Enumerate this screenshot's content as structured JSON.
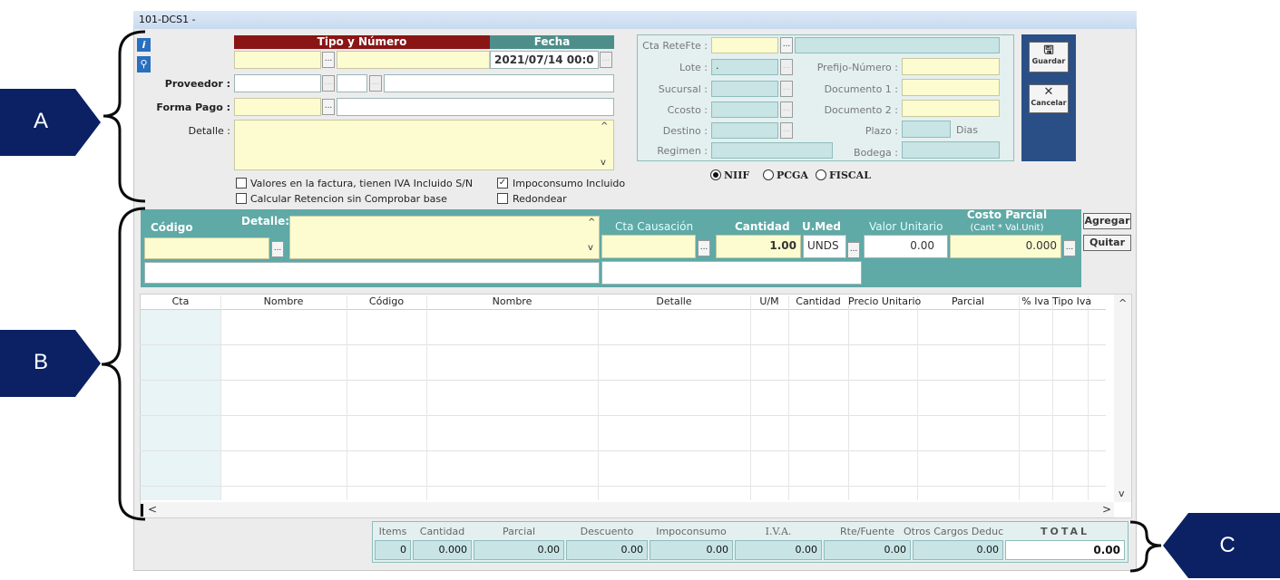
{
  "window": {
    "title": "101-DCS1 -"
  },
  "header": {
    "tipo_numero_label": "Tipo y Número",
    "fecha_label": "Fecha",
    "fecha_value": "2021/07/14 00:0",
    "proveedor_label": "Proveedor :",
    "forma_pago_label": "Forma Pago :",
    "detalle_label": "Detalle :",
    "checks": [
      {
        "label": "Valores en la factura, tienen  IVA Incluido S/N",
        "checked": false
      },
      {
        "label": "Calcular Retencion sin Comprobar base",
        "checked": false
      },
      {
        "label": "Impoconsumo Incluido",
        "checked": true
      },
      {
        "label": "Redondear",
        "checked": false
      }
    ]
  },
  "right_panel": {
    "cta_retefte": "Cta ReteFte :",
    "lote": "Lote :",
    "lote_value": ".",
    "sucursal": "Sucursal :",
    "ccosto": "Ccosto :",
    "destino": "Destino :",
    "regimen": "Regimen :",
    "prefijo": "Prefijo-Número :",
    "documento1": "Documento 1 :",
    "documento2": "Documento 2 :",
    "plazo": "Plazo :",
    "dias": "Dias",
    "bodega": "Bodega :"
  },
  "radios": [
    {
      "label": "NIIF",
      "selected": true
    },
    {
      "label": "PCGA",
      "selected": false
    },
    {
      "label": "FISCAL",
      "selected": false
    }
  ],
  "actions": {
    "guardar": "Guardar",
    "cancelar": "Cancelar",
    "agregar": "Agregar",
    "quitar": "Quitar"
  },
  "line": {
    "codigo": "Código",
    "detalle": "Detalle:",
    "cta_causacion": "Cta Causación",
    "cantidad": "Cantidad",
    "umed": "U.Med",
    "valor_unitario": "Valor Unitario",
    "costo_parcial": "Costo Parcial",
    "costo_parcial_sub": "(Cant * Val.Unit)",
    "cantidad_value": "1.00",
    "umed_value": "UNDS",
    "valor_value": "0.00",
    "costo_value": "0.000"
  },
  "grid": {
    "columns": [
      "Cta",
      "Nombre",
      "Código",
      "Nombre",
      "Detalle",
      "U/M",
      "Cantidad",
      "Precio Unitario",
      "Parcial",
      "% Iva",
      "Tipo Iva"
    ]
  },
  "totals": {
    "labels": [
      "Items",
      "Cantidad",
      "Parcial",
      "Descuento",
      "Impoconsumo",
      "I.V.A.",
      "Rte/Fuente",
      "Otros Cargos Deduc",
      "TOTAL"
    ],
    "values": [
      "0",
      "0.000",
      "0.00",
      "0.00",
      "0.00",
      "0.00",
      "0.00",
      "0.00",
      "0.00"
    ]
  },
  "annotations": {
    "a": "A",
    "b": "B",
    "c": "C"
  }
}
